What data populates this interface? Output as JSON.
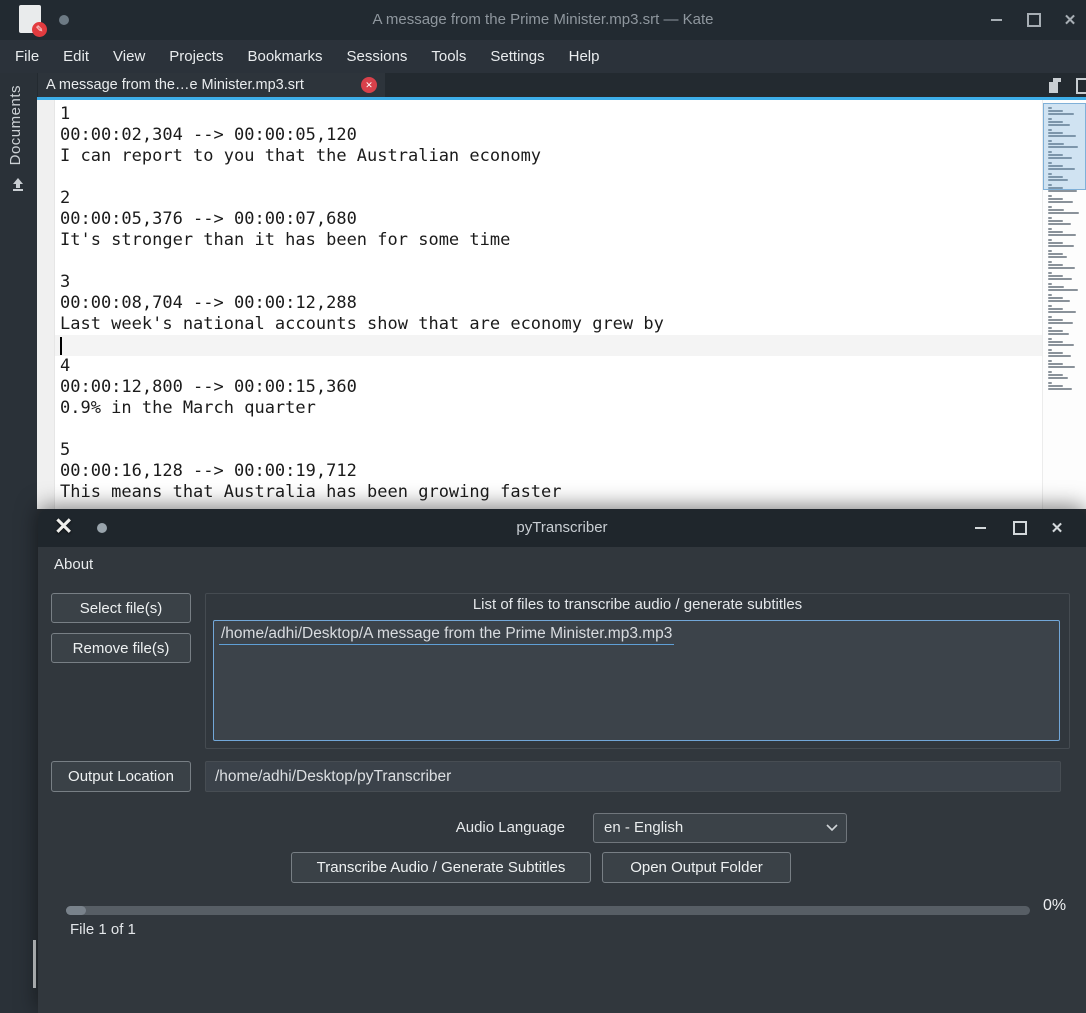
{
  "kate": {
    "titlebar": {
      "title": "A message from the Prime Minister.mp3.srt — Kate"
    },
    "menu": [
      "File",
      "Edit",
      "View",
      "Projects",
      "Bookmarks",
      "Sessions",
      "Tools",
      "Settings",
      "Help"
    ],
    "tab": {
      "label": "A message from the…e Minister.mp3.srt"
    },
    "sidebar": {
      "label": "Documents"
    },
    "editor": {
      "lines": [
        "1",
        "00:00:02,304 --> 00:00:05,120",
        "I can report to you that the Australian economy",
        "",
        "2",
        "00:00:05,376 --> 00:00:07,680",
        "It's stronger than it has been for some time",
        "",
        "3",
        "00:00:08,704 --> 00:00:12,288",
        "Last week's national accounts show that are economy grew by",
        "",
        "4",
        "00:00:12,800 --> 00:00:15,360",
        "0.9% in the March quarter",
        "",
        "5",
        "00:00:16,128 --> 00:00:19,712",
        "This means that Australia has been growing faster"
      ],
      "cursor_line_index": 11
    },
    "minimap": {
      "groups": [
        [
          4,
          15,
          26
        ],
        [
          4,
          15,
          22
        ],
        [
          4,
          15,
          28
        ],
        [
          4,
          16,
          30
        ],
        [
          4,
          15,
          24
        ],
        [
          4,
          15,
          27
        ],
        [
          4,
          15,
          20
        ],
        [
          4,
          15,
          29
        ],
        [
          4,
          15,
          25
        ],
        [
          4,
          16,
          31
        ],
        [
          4,
          15,
          23
        ],
        [
          4,
          15,
          28
        ],
        [
          4,
          15,
          26
        ],
        [
          4,
          15,
          19
        ],
        [
          4,
          15,
          27
        ],
        [
          4,
          15,
          24
        ],
        [
          4,
          16,
          30
        ],
        [
          4,
          15,
          22
        ],
        [
          4,
          15,
          28
        ],
        [
          4,
          15,
          25
        ],
        [
          4,
          15,
          21
        ],
        [
          4,
          15,
          26
        ],
        [
          4,
          15,
          23
        ],
        [
          4,
          15,
          27
        ],
        [
          4,
          15,
          20
        ],
        [
          4,
          15,
          24
        ]
      ]
    }
  },
  "pytranscriber": {
    "titlebar": {
      "title": "pyTranscriber"
    },
    "menu": {
      "about": "About"
    },
    "buttons": {
      "select": "Select file(s)",
      "remove": "Remove file(s)",
      "output_location": "Output Location",
      "transcribe": "Transcribe Audio / Generate Subtitles",
      "open_output": "Open Output Folder"
    },
    "group_title": "List of files to transcribe audio / generate subtitles",
    "file_list": [
      "/home/adhi/Desktop/A message from the Prime Minister.mp3.mp3"
    ],
    "output_path": "/home/adhi/Desktop/pyTranscriber",
    "audio_language_label": "Audio Language",
    "audio_language_value": "en - English",
    "progress": {
      "percent": "0%",
      "file_label": "File 1 of 1"
    }
  },
  "colors": {
    "accent_blue": "#3daee9",
    "list_border_blue": "#72a7d8",
    "tab_close_red": "#d8414b",
    "editor_bg": "#ffffff",
    "dark_titlebar": "#1f262c",
    "window_bg": "#31373d"
  }
}
